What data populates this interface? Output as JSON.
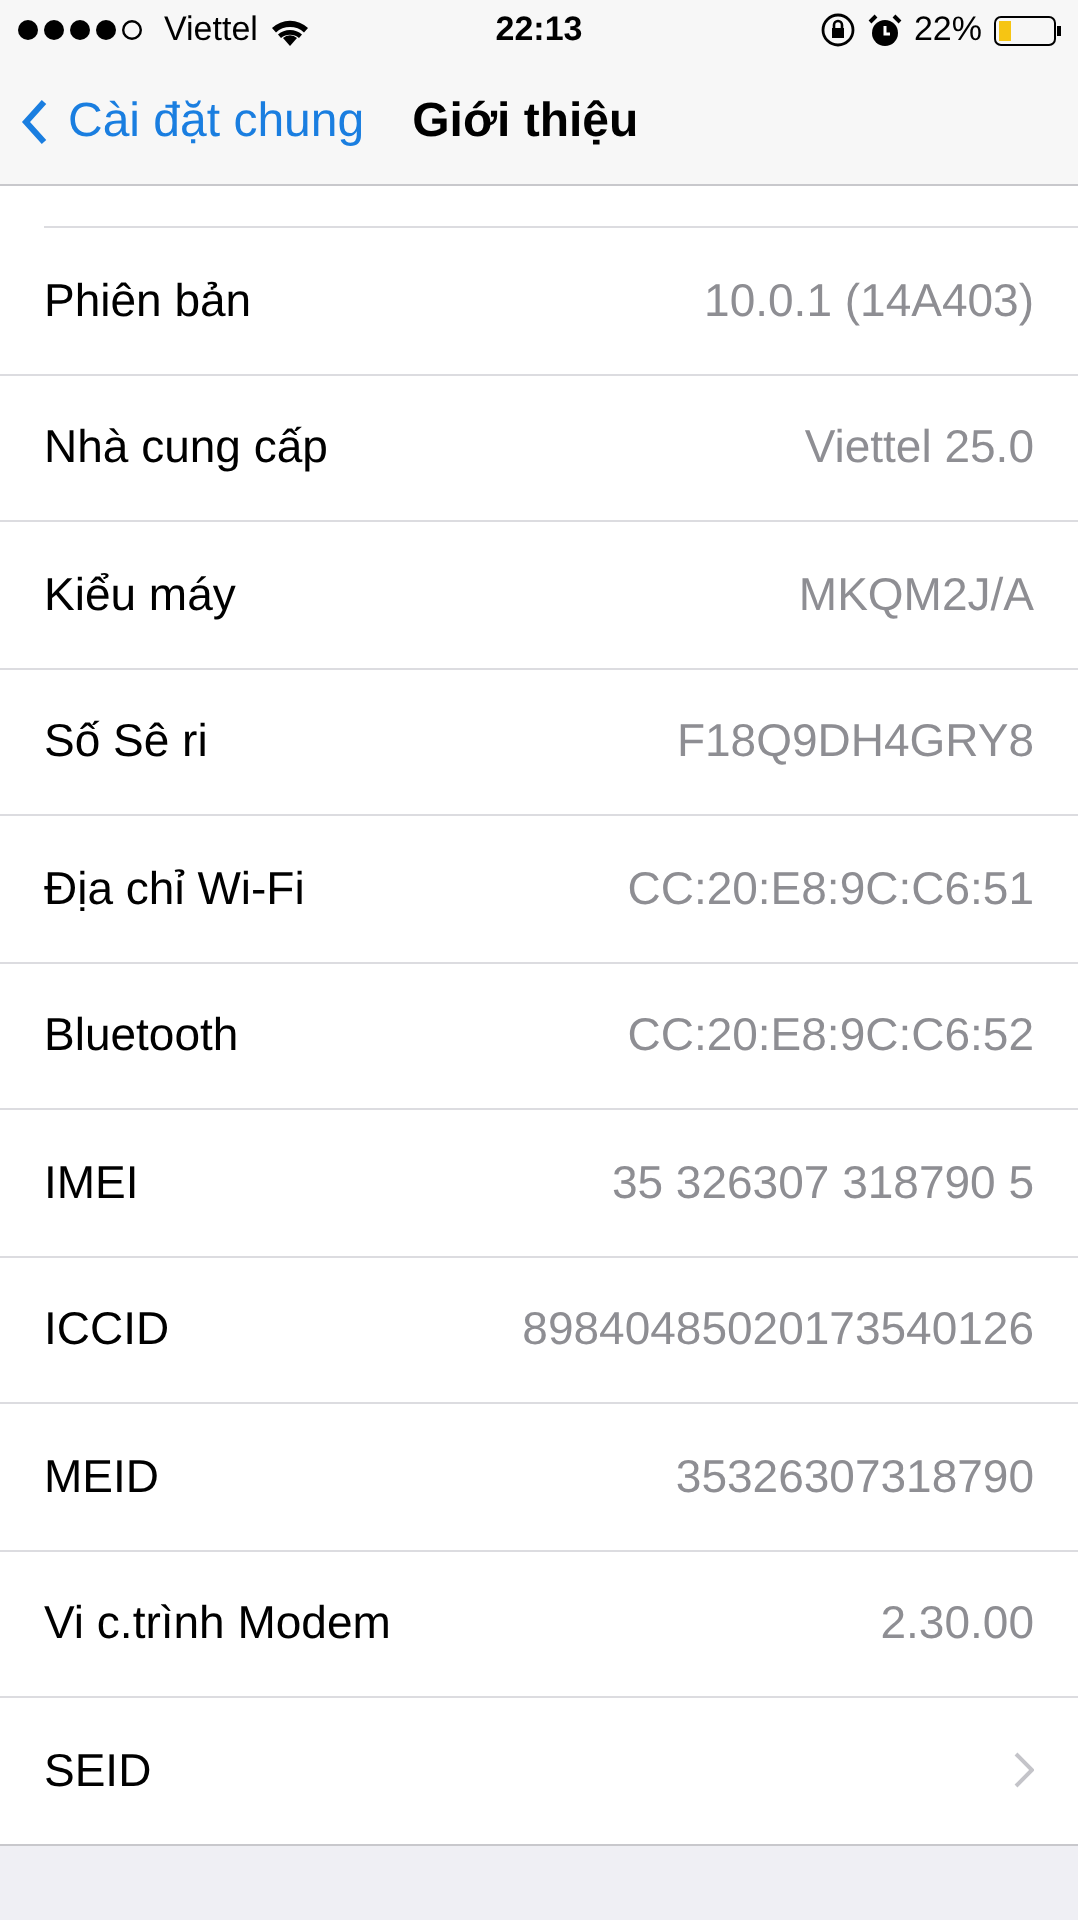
{
  "status_bar": {
    "carrier": "Viettel",
    "time": "22:13",
    "battery": "22%"
  },
  "nav": {
    "back": "Cài đặt chung",
    "title": "Giới thiệu"
  },
  "rows": [
    {
      "kind": "value",
      "label": "Phiên bản",
      "value": "10.0.1 (14A403)"
    },
    {
      "kind": "value",
      "label": "Nhà cung cấp",
      "value": "Viettel 25.0"
    },
    {
      "kind": "value",
      "label": "Kiểu máy",
      "value": "MKQM2J/A"
    },
    {
      "kind": "value",
      "label": "Số Sê ri",
      "value": "F18Q9DH4GRY8"
    },
    {
      "kind": "value",
      "label": "Địa chỉ Wi-Fi",
      "value": "CC:20:E8:9C:C6:51"
    },
    {
      "kind": "value",
      "label": "Bluetooth",
      "value": "CC:20:E8:9C:C6:52"
    },
    {
      "kind": "value",
      "label": "IMEI",
      "value": "35 326307 318790 5"
    },
    {
      "kind": "value",
      "label": "ICCID",
      "value": "89840485020173540126"
    },
    {
      "kind": "value",
      "label": "MEID",
      "value": "35326307318790"
    },
    {
      "kind": "value",
      "label": "Vi c.trình Modem",
      "value": "2.30.00"
    },
    {
      "kind": "disclosure",
      "label": "SEID"
    }
  ]
}
